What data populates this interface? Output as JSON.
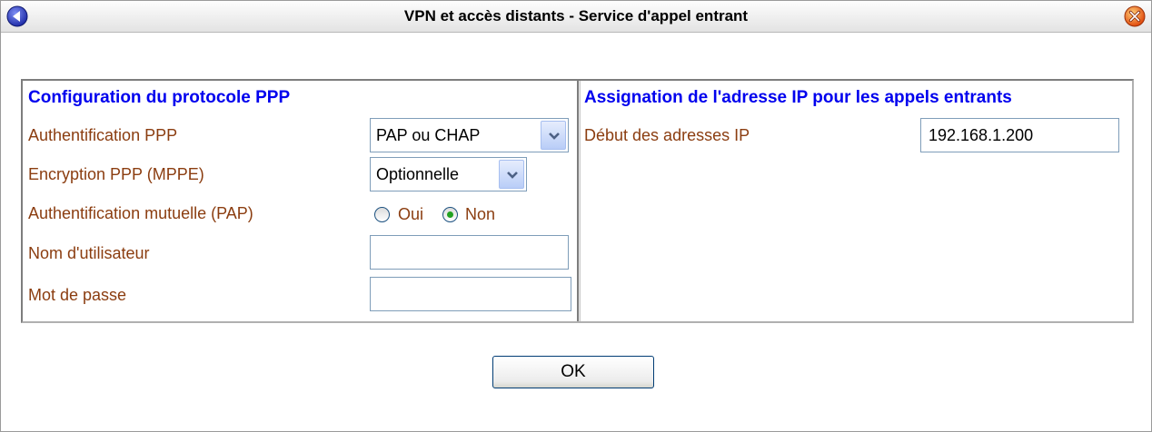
{
  "window": {
    "title": "VPN et accès distants - Service d'appel entrant"
  },
  "ppp": {
    "section_title": "Configuration du protocole PPP",
    "auth_label": "Authentification PPP",
    "auth_value": "PAP ou CHAP",
    "encryption_label": "Encryption PPP (MPPE)",
    "encryption_value": "Optionnelle",
    "mutual_label": "Authentification mutuelle (PAP)",
    "mutual_options": [
      {
        "label": "Oui",
        "selected": false
      },
      {
        "label": "Non",
        "selected": true
      }
    ],
    "username_label": "Nom d'utilisateur",
    "username_value": "",
    "password_label": "Mot de passe",
    "password_value": ""
  },
  "ip": {
    "section_title": "Assignation de l'adresse IP pour les appels entrants",
    "start_label": "Début des adresses IP",
    "start_value": "192.168.1.200"
  },
  "actions": {
    "ok_label": "OK"
  },
  "colors": {
    "section_title": "#0000ee",
    "label": "#8b3d10",
    "radio_selected": "#21a121"
  },
  "icons": {
    "back": "back-arrow-icon",
    "close": "close-icon",
    "dropdown": "chevron-down-icon"
  }
}
